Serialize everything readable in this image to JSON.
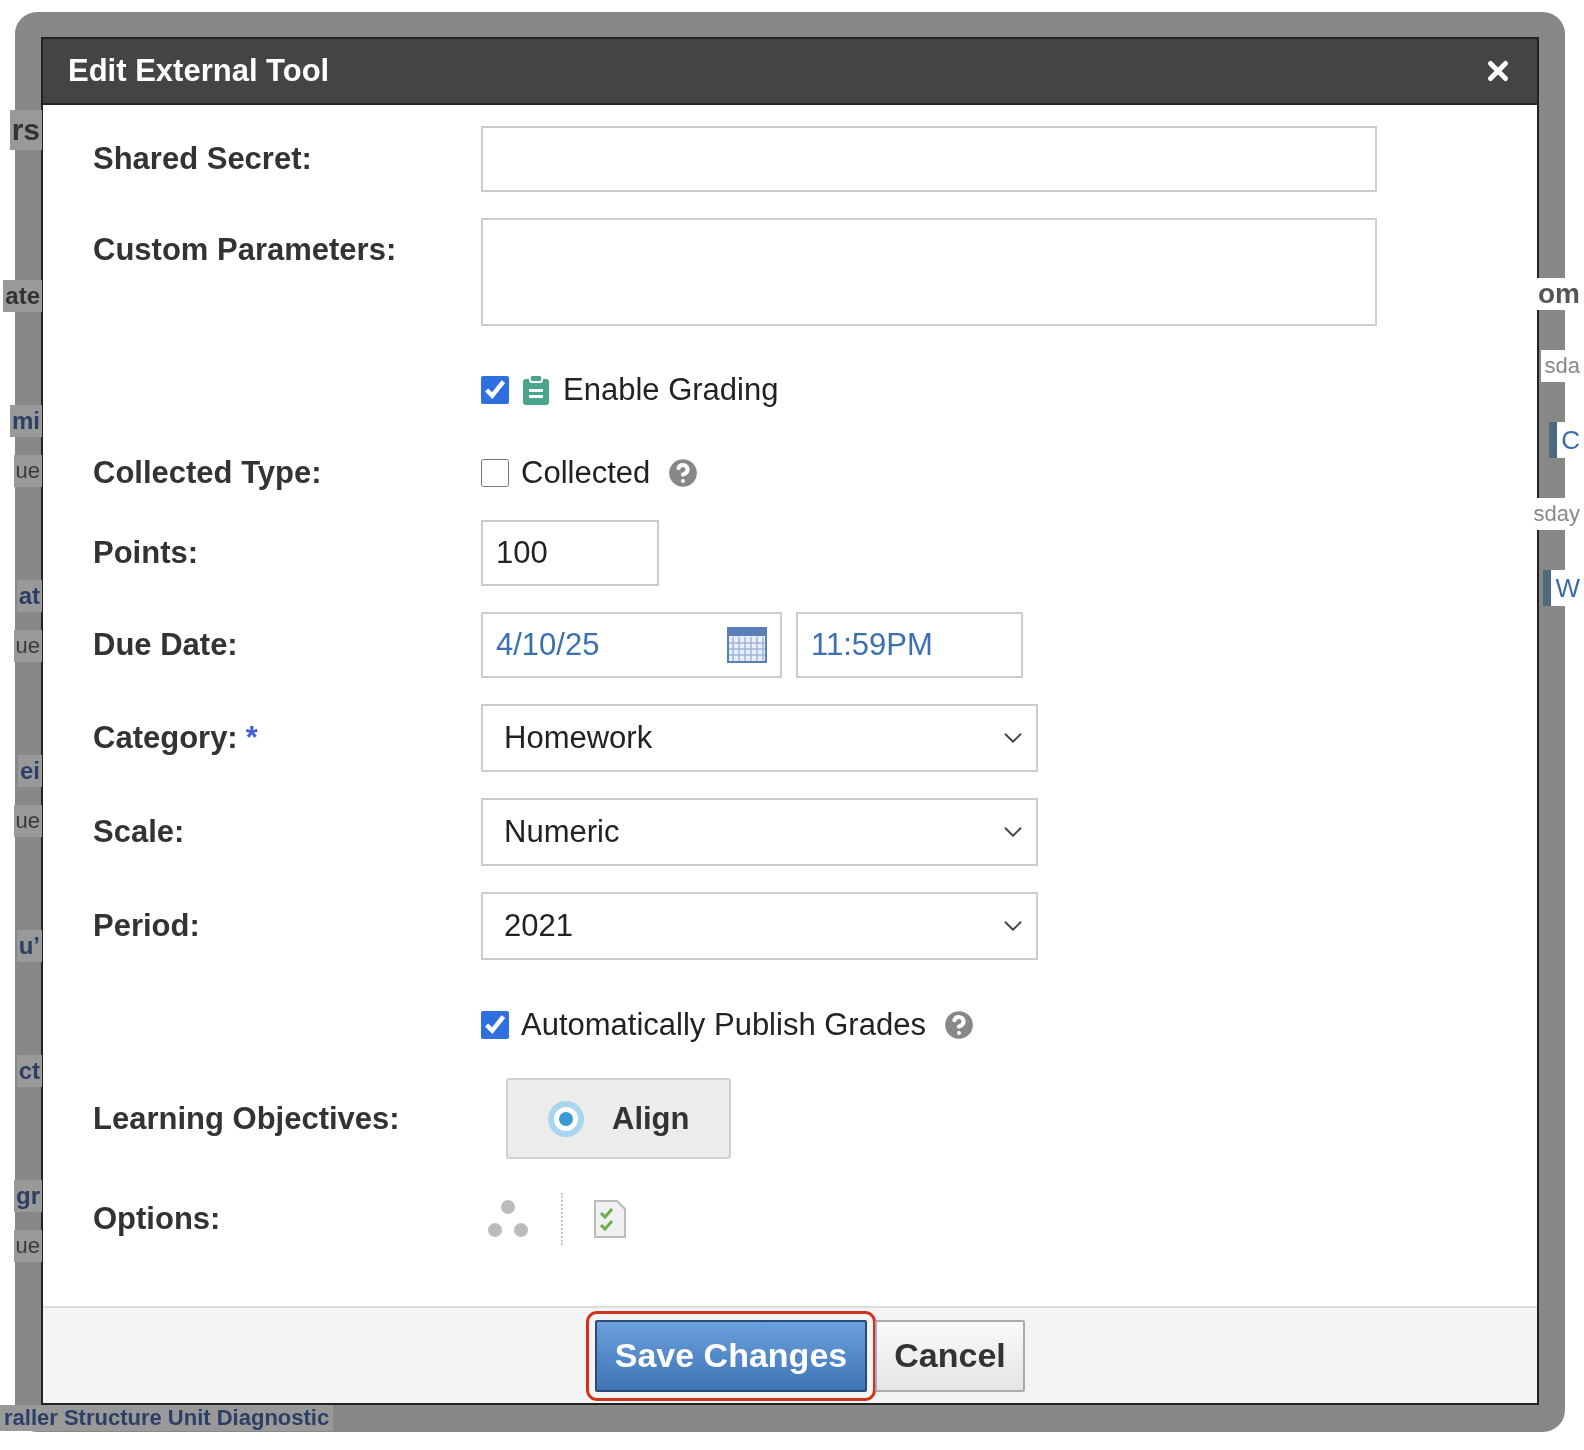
{
  "background": {
    "left_fragments": [
      {
        "text": "rs",
        "kind": "heading"
      },
      {
        "text": "ate",
        "kind": "column"
      },
      {
        "text": "mi",
        "kind": "link"
      },
      {
        "text": "ue",
        "kind": "meta"
      },
      {
        "text": "at",
        "kind": "link"
      },
      {
        "text": "ue",
        "kind": "meta"
      },
      {
        "text": "ei",
        "kind": "link"
      },
      {
        "text": "ue",
        "kind": "meta"
      },
      {
        "text": "u’",
        "kind": "link"
      },
      {
        "text": "ct",
        "kind": "link"
      },
      {
        "text": "gr",
        "kind": "link"
      },
      {
        "text": "ue",
        "kind": "meta"
      }
    ],
    "right_fragments": [
      {
        "text": "om",
        "kind": "column"
      },
      {
        "text": "sda",
        "kind": "meta"
      },
      {
        "text": "C",
        "kind": "event"
      },
      {
        "text": "sday",
        "kind": "meta"
      },
      {
        "text": "W",
        "kind": "event"
      }
    ],
    "bottom_title": "raller Structure Unit Diagnostic"
  },
  "dialog": {
    "title": "Edit External Tool",
    "fields": [
      {
        "kind": "text",
        "label": "Shared Secret:"
      },
      {
        "kind": "textarea",
        "label": "Custom Parameters:"
      },
      {
        "kind": "grading",
        "text": "Enable Grading",
        "checked": true
      },
      {
        "kind": "checkbox",
        "label": "Collected Type:",
        "text": "Collected",
        "checked": false,
        "help": true
      },
      {
        "kind": "number",
        "label": "Points:",
        "value": "100"
      },
      {
        "kind": "date",
        "label": "Due Date:",
        "value": "4/10/25",
        "time": "11:59PM"
      },
      {
        "kind": "select",
        "label": "Category:",
        "required_mark": "*",
        "value": "Homework"
      },
      {
        "kind": "select",
        "label": "Scale:",
        "value": "Numeric"
      },
      {
        "kind": "select",
        "label": "Period:",
        "value": "2021"
      },
      {
        "kind": "checkbox",
        "text": "Automatically Publish Grades",
        "checked": true,
        "help": true
      },
      {
        "kind": "button",
        "label": "Learning Objectives:",
        "value": "Align"
      },
      {
        "kind": "icons",
        "label": "Options:"
      }
    ],
    "buttons": [
      {
        "label": "Save Changes",
        "kind": "primary",
        "focused": true
      },
      {
        "label": "Cancel",
        "kind": "secondary",
        "focused": false
      }
    ]
  }
}
